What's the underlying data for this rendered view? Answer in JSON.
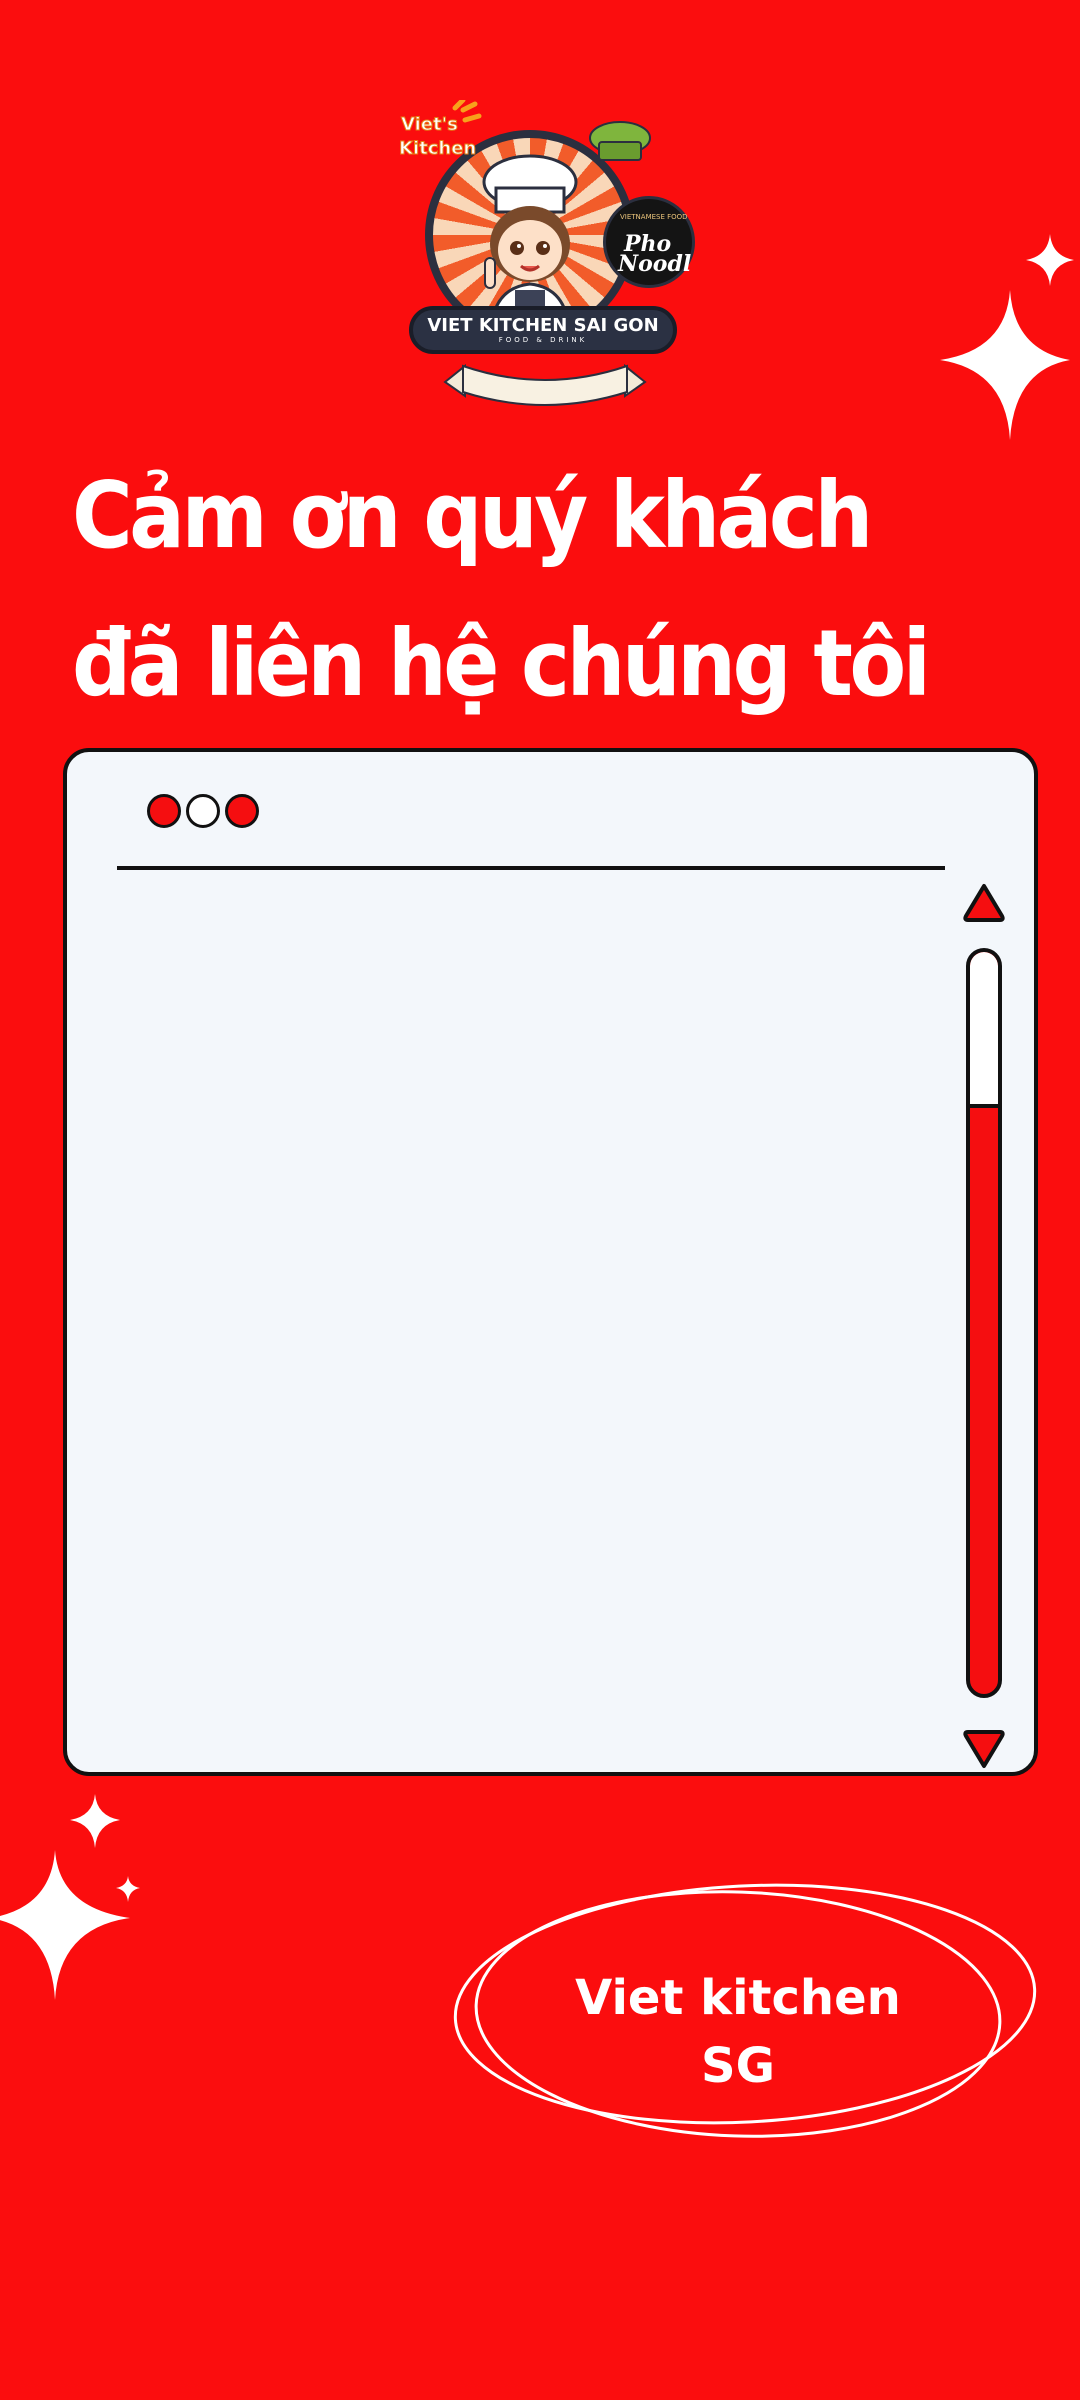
{
  "logo": {
    "badge_text_line1": "Viet's",
    "badge_text_line2": "Kitchen",
    "banner_title": "VIET KITCHEN SAI GON",
    "banner_subtitle": "FOOD & DRINK",
    "side_badge_top": "VIETNAMESE FOOD",
    "side_badge_line1": "Pho",
    "side_badge_line2": "Noodle",
    "icon": "chef-mascot-icon"
  },
  "heading": {
    "line1": "Cảm ơn quý khách",
    "line2": "đã liên hệ chúng tôi"
  },
  "window": {
    "dot_colors": [
      "#f50e10",
      "#ffffff",
      "#f50e10"
    ],
    "scrollbar": {
      "thumb_fraction": 0.21
    },
    "scroll_up_icon": "triangle-up-icon",
    "scroll_down_icon": "triangle-down-icon"
  },
  "brand": {
    "line1": "Viet kitchen",
    "line2": "SG"
  },
  "colors": {
    "background": "#fb0d0e",
    "window_bg": "#f3f7fb",
    "accent_red": "#f50e10",
    "outline": "#111111",
    "banner_dark": "#2b3143"
  }
}
